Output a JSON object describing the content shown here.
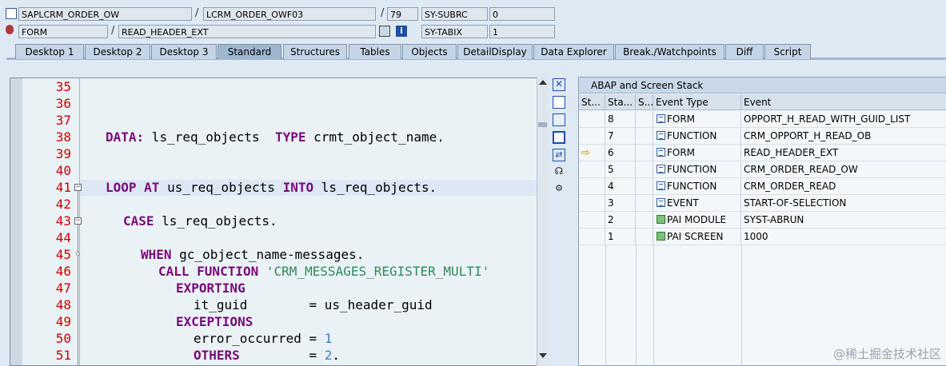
{
  "header": {
    "row1": {
      "program": "SAPLCRM_ORDER_OW",
      "include": "LCRM_ORDER_OWF03",
      "line": "79",
      "var_label": "SY-SUBRC",
      "var_value": "0"
    },
    "row2": {
      "event_type": "FORM",
      "event_name": "READ_HEADER_EXT",
      "var_label": "SY-TABIX",
      "var_value": "1"
    }
  },
  "tabs": [
    {
      "label": "Desktop 1"
    },
    {
      "label": "Desktop 2"
    },
    {
      "label": "Desktop 3"
    },
    {
      "label": "Standard",
      "active": true
    },
    {
      "label": "Structures"
    },
    {
      "label": "Tables"
    },
    {
      "label": "Objects"
    },
    {
      "label": "DetailDisplay"
    },
    {
      "label": "Data Explorer"
    },
    {
      "label": "Break./Watchpoints"
    },
    {
      "label": "Diff"
    },
    {
      "label": "Script"
    }
  ],
  "editor": {
    "lines": [
      "35",
      "36",
      "37",
      "38",
      "39",
      "40",
      "41",
      "42",
      "43",
      "44",
      "45",
      "46",
      "47",
      "48",
      "49",
      "50",
      "51"
    ],
    "code": {
      "l38_kw1": "DATA:",
      "l38_t1": " ls_req_objects  ",
      "l38_kw2": "TYPE",
      "l38_t2": " crmt_object_name.",
      "l41_kw1": "LOOP AT",
      "l41_t1": " us_req_objects ",
      "l41_kw2": "INTO",
      "l41_t2": " ls_req_objects.",
      "l43_kw1": "CASE",
      "l43_t1": " ls_req_objects.",
      "l45_kw1": "WHEN",
      "l45_t1": " gc_object_name-messages.",
      "l46_kw1": "CALL FUNCTION",
      "l46_str": " 'CRM_MESSAGES_REGISTER_MULTI'",
      "l47_kw1": "EXPORTING",
      "l48_t1": "it_guid        = us_header_guid",
      "l49_kw1": "EXCEPTIONS",
      "l50_t1": "error_occurred = ",
      "l50_num": "1",
      "l51_kw1": "OTHERS",
      "l51_t1": "         = ",
      "l51_num": "2",
      "l51_t2": "."
    }
  },
  "stack": {
    "title": "ABAP and Screen Stack",
    "columns": [
      "St...",
      "Sta...",
      "S...",
      "Event Type",
      "Event"
    ],
    "rows": [
      {
        "level": "8",
        "icon": "document-icon",
        "type": "FORM",
        "event": "OPPORT_H_READ_WITH_GUID_LIST"
      },
      {
        "level": "7",
        "icon": "document-icon",
        "type": "FUNCTION",
        "event": "CRM_OPPORT_H_READ_OB"
      },
      {
        "level": "6",
        "icon": "document-icon",
        "type": "FORM",
        "event": "READ_HEADER_EXT",
        "current": true
      },
      {
        "level": "5",
        "icon": "document-icon",
        "type": "FUNCTION",
        "event": "CRM_ORDER_READ_OW"
      },
      {
        "level": "4",
        "icon": "document-icon",
        "type": "FUNCTION",
        "event": "CRM_ORDER_READ"
      },
      {
        "level": "3",
        "icon": "document-icon",
        "type": "EVENT",
        "event": "START-OF-SELECTION"
      },
      {
        "level": "2",
        "icon": "screen-icon",
        "type": "PAI MODULE",
        "event": "SYST-ABRUN"
      },
      {
        "level": "1",
        "icon": "screen-icon",
        "type": "PAI SCREEN",
        "event": "1000"
      }
    ],
    "current_marker": "⇨"
  },
  "watermark": "@稀土掘金技术社区"
}
